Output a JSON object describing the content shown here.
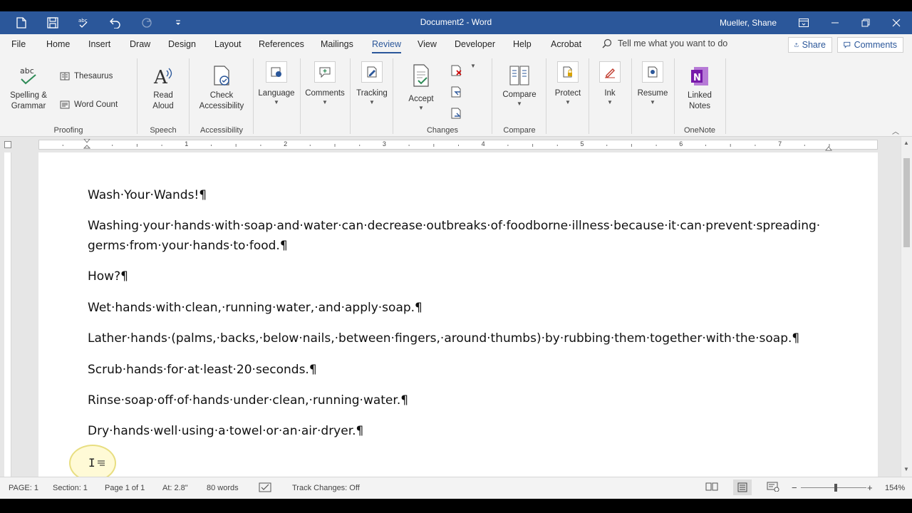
{
  "window": {
    "title": "Document2  -  Word",
    "user": "Mueller, Shane"
  },
  "tabs": [
    "File",
    "Home",
    "Insert",
    "Draw",
    "Design",
    "Layout",
    "References",
    "Mailings",
    "Review",
    "View",
    "Developer",
    "Help",
    "Acrobat"
  ],
  "active_tab": "Review",
  "tellme": "Tell me what you want to do",
  "share_label": "Share",
  "comments_label": "Comments",
  "ribbon": {
    "spelling": "Spelling &\nGrammar",
    "spelling_icon_text": "abc",
    "thesaurus": "Thesaurus",
    "word_count": "Word Count",
    "read_aloud": "Read\nAloud",
    "check_accessibility": "Check\nAccessibility",
    "language": "Language",
    "comments": "Comments",
    "tracking": "Tracking",
    "accept": "Accept",
    "compare": "Compare",
    "protect": "Protect",
    "ink": "Ink",
    "resume": "Resume",
    "linked_notes": "Linked\nNotes",
    "onenote_glyph": "N",
    "groups": {
      "proofing": "Proofing",
      "speech": "Speech",
      "accessibility": "Accessibility",
      "changes": "Changes",
      "compare": "Compare",
      "onenote": "OneNote"
    }
  },
  "ruler_numbers": [
    "1",
    "2",
    "3",
    "4",
    "5",
    "6",
    "7"
  ],
  "document": {
    "paragraphs": [
      "Wash·Your·Wands!¶",
      "Washing·your·hands·with·soap·and·water·can·decrease·outbreaks·of·foodborne·illness·because·it·can·prevent·spreading·\ngerms·from·your·hands·to·food.¶",
      "How?¶",
      "Wet·hands·with·clean,·running·water,·and·apply·soap.¶",
      "Lather·hands·(palms,·backs,·below·nails,·between·fingers,·around·thumbs)·by·rubbing·them·together·with·the·soap.¶",
      "Scrub·hands·for·at·least·20·seconds.¶",
      "Rinse·soap·off·of·hands·under·clean,·running·water.¶",
      "Dry·hands·well·using·a·towel·or·an·air·dryer.¶"
    ]
  },
  "status": {
    "page": "PAGE: 1",
    "section": "Section: 1",
    "pages": "Page 1 of 1",
    "at": "At: 2.8\"",
    "words": "80 words",
    "track_changes": "Track Changes: Off",
    "zoom": "154%",
    "zoom_minus": "−",
    "zoom_plus": "+"
  },
  "colors": {
    "accent": "#2b579a",
    "onenote": "#7719aa"
  }
}
